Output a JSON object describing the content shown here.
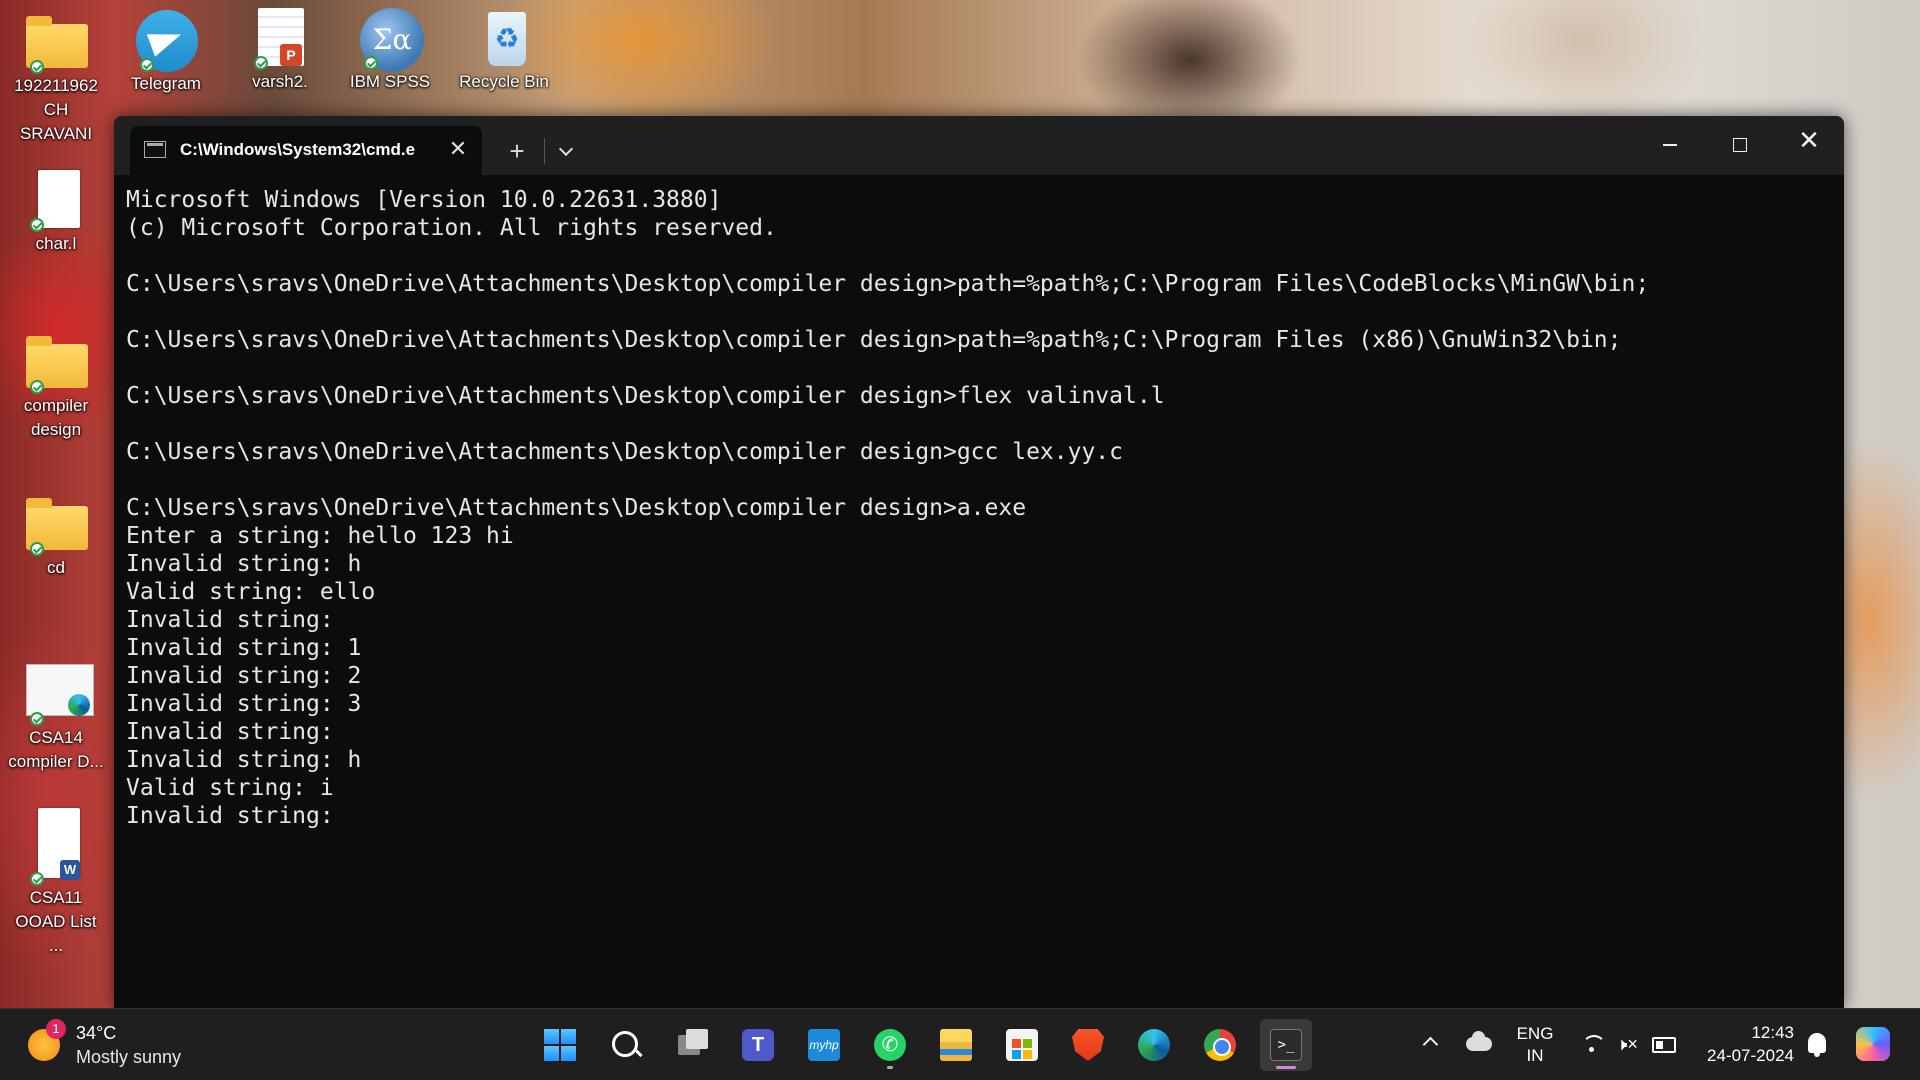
{
  "desktop": {
    "icons": [
      {
        "label": "192211962\nCH SRAVANI",
        "icon": "folder-icon"
      },
      {
        "label": "Telegram",
        "icon": "telegram-icon"
      },
      {
        "label": "varsh2.",
        "icon": "powerpoint-file-icon"
      },
      {
        "label": "IBM SPSS",
        "icon": "ibm-spss-icon"
      },
      {
        "label": "Recycle Bin",
        "icon": "recycle-bin-icon"
      },
      {
        "label": "char.l",
        "icon": "file-icon"
      },
      {
        "label": "compiler\ndesign",
        "icon": "folder-icon"
      },
      {
        "label": "cd",
        "icon": "folder-icon"
      },
      {
        "label": "CSA14\ncompiler D...",
        "icon": "edge-document-icon"
      },
      {
        "label": "CSA11\nOOAD List ...",
        "icon": "word-document-icon"
      }
    ]
  },
  "terminal": {
    "tab_title": "C:\\Windows\\System32\\cmd.e",
    "lines": [
      "Microsoft Windows [Version 10.0.22631.3880]",
      "(c) Microsoft Corporation. All rights reserved.",
      "",
      "C:\\Users\\sravs\\OneDrive\\Attachments\\Desktop\\compiler design>path=%path%;C:\\Program Files\\CodeBlocks\\MinGW\\bin;",
      "",
      "C:\\Users\\sravs\\OneDrive\\Attachments\\Desktop\\compiler design>path=%path%;C:\\Program Files (x86)\\GnuWin32\\bin;",
      "",
      "C:\\Users\\sravs\\OneDrive\\Attachments\\Desktop\\compiler design>flex valinval.l",
      "",
      "C:\\Users\\sravs\\OneDrive\\Attachments\\Desktop\\compiler design>gcc lex.yy.c",
      "",
      "C:\\Users\\sravs\\OneDrive\\Attachments\\Desktop\\compiler design>a.exe",
      "Enter a string: hello 123 hi",
      "Invalid string: h",
      "Valid string: ello",
      "Invalid string:",
      "Invalid string: 1",
      "Invalid string: 2",
      "Invalid string: 3",
      "Invalid string:",
      "Invalid string: h",
      "Valid string: i",
      "Invalid string:"
    ]
  },
  "taskbar": {
    "weather": {
      "badge": "1",
      "temp": "34°C",
      "desc": "Mostly sunny"
    },
    "apps": [
      {
        "name": "start",
        "icon": "windows-start-icon"
      },
      {
        "name": "search",
        "icon": "search-icon"
      },
      {
        "name": "task-view",
        "icon": "task-view-icon"
      },
      {
        "name": "teams",
        "icon": "teams-icon",
        "glyph": "T"
      },
      {
        "name": "myhp",
        "icon": "myhp-icon",
        "glyph": "myhp"
      },
      {
        "name": "whatsapp",
        "icon": "whatsapp-icon",
        "glyph": "✆"
      },
      {
        "name": "file-explorer",
        "icon": "file-explorer-icon"
      },
      {
        "name": "microsoft-store",
        "icon": "store-icon"
      },
      {
        "name": "brave",
        "icon": "brave-icon"
      },
      {
        "name": "edge",
        "icon": "edge-icon"
      },
      {
        "name": "chrome",
        "icon": "chrome-icon"
      },
      {
        "name": "terminal",
        "icon": "terminal-icon",
        "glyph": ">_"
      }
    ],
    "tray": {
      "lang_line1": "ENG",
      "lang_line2": "IN",
      "volume_glyph": "🕨×",
      "time": "12:43",
      "date": "24-07-2024"
    }
  },
  "colors": {
    "terminal_bg": "#0c0c0c",
    "terminal_fg": "#e6e6e6",
    "titlebar_bg": "#202020",
    "taskbar_bg": "#1f1f1f",
    "active_indicator": "#d48ad8"
  }
}
